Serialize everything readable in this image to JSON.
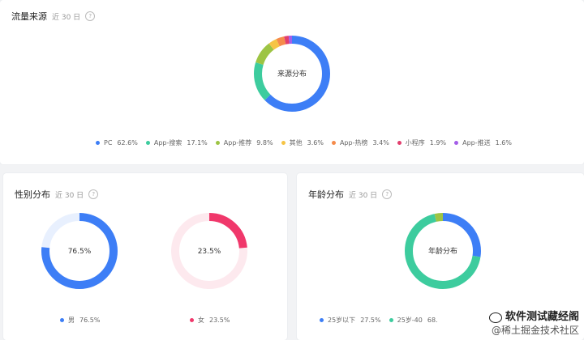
{
  "traffic": {
    "title": "流量来源",
    "range": "近 30 日",
    "help": "?",
    "center_label": "来源分布",
    "items": [
      {
        "name": "PC",
        "value": "62.6%",
        "pct": 62.6,
        "color": "#3d7ef6"
      },
      {
        "name": "App-搜索",
        "value": "17.1%",
        "pct": 17.1,
        "color": "#3dcc9e"
      },
      {
        "name": "App-推荐",
        "value": "9.8%",
        "pct": 9.8,
        "color": "#9dc444"
      },
      {
        "name": "其他",
        "value": "3.6%",
        "pct": 3.6,
        "color": "#f6c445"
      },
      {
        "name": "App-热榜",
        "value": "3.4%",
        "pct": 3.4,
        "color": "#f58b4b"
      },
      {
        "name": "小程序",
        "value": "1.9%",
        "pct": 1.9,
        "color": "#e23e6d"
      },
      {
        "name": "App-推送",
        "value": "1.6%",
        "pct": 1.6,
        "color": "#a45ee8"
      }
    ]
  },
  "gender": {
    "title": "性别分布",
    "range": "近 30 日",
    "help": "?",
    "male": {
      "name": "男",
      "value": "76.5%",
      "pct": 76.5,
      "color": "#3d7ef6",
      "track": "#e8f0fe",
      "center_label": "76.5%"
    },
    "female": {
      "name": "女",
      "value": "23.5%",
      "pct": 23.5,
      "color": "#f0386b",
      "track": "#fde9ee",
      "center_label": "23.5%"
    }
  },
  "age": {
    "title": "年龄分布",
    "range": "近 30 日",
    "help": "?",
    "center_label": "年龄分布",
    "items": [
      {
        "name": "25岁以下",
        "value": "27.5%",
        "pct": 27.5,
        "color": "#3d7ef6"
      },
      {
        "name": "25岁-40",
        "value": "68.",
        "pct": 68.8,
        "color": "#3dcc9e"
      },
      {
        "name": "",
        "value": "",
        "pct": 3.7,
        "color": "#9dc444"
      }
    ]
  },
  "watermark": {
    "line1": "软件测试藏经阁",
    "line2": "@稀土掘金技术社区"
  }
}
